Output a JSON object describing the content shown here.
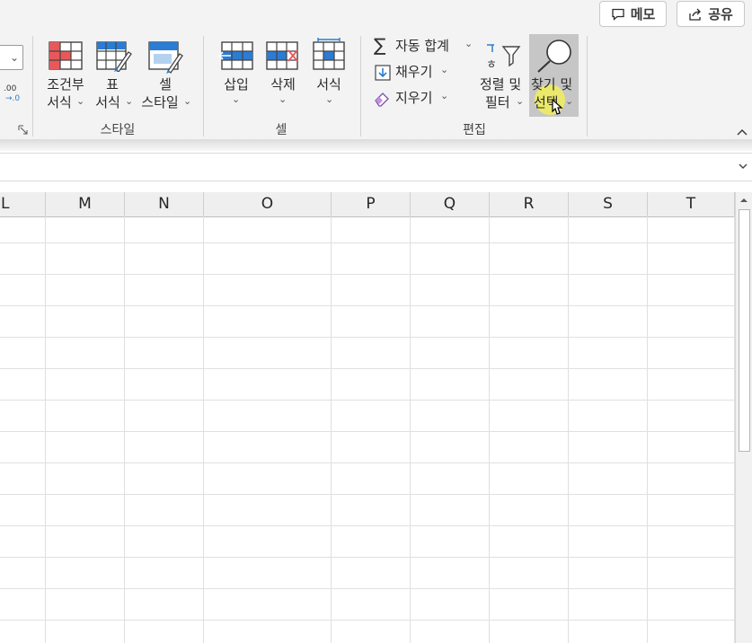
{
  "top_buttons": {
    "memo": "메모",
    "share": "공유"
  },
  "number_format": {
    "decimal_label": ".00\n→.0"
  },
  "style_group": {
    "label": "스타일",
    "conditional_format": {
      "line1": "조건부",
      "line2": "서식"
    },
    "table_format": {
      "line1": "표",
      "line2": "서식"
    },
    "cell_style": {
      "line1": "셀",
      "line2": "스타일"
    }
  },
  "cells_group": {
    "label": "셀",
    "insert": "삽입",
    "delete": "삭제",
    "format": "서식"
  },
  "edit_group": {
    "label": "편집",
    "autosum": "자동 합계",
    "fill": "채우기",
    "clear": "지우기",
    "sort_filter": {
      "line1": "정렬 및",
      "line2": "필터"
    },
    "find_select": {
      "line1": "찾기 및",
      "line2": "선택"
    }
  },
  "columns": [
    "L",
    "M",
    "N",
    "O",
    "P",
    "Q",
    "R",
    "S",
    "T"
  ],
  "colors": {
    "ribbon_bg": "#f3f3f3",
    "hover_bg": "#c6c6c6",
    "cursor_highlight": "#f1ef5c",
    "icon_blue": "#2b7cd3",
    "icon_red": "#e8585b",
    "memo_green": "#107c41"
  }
}
